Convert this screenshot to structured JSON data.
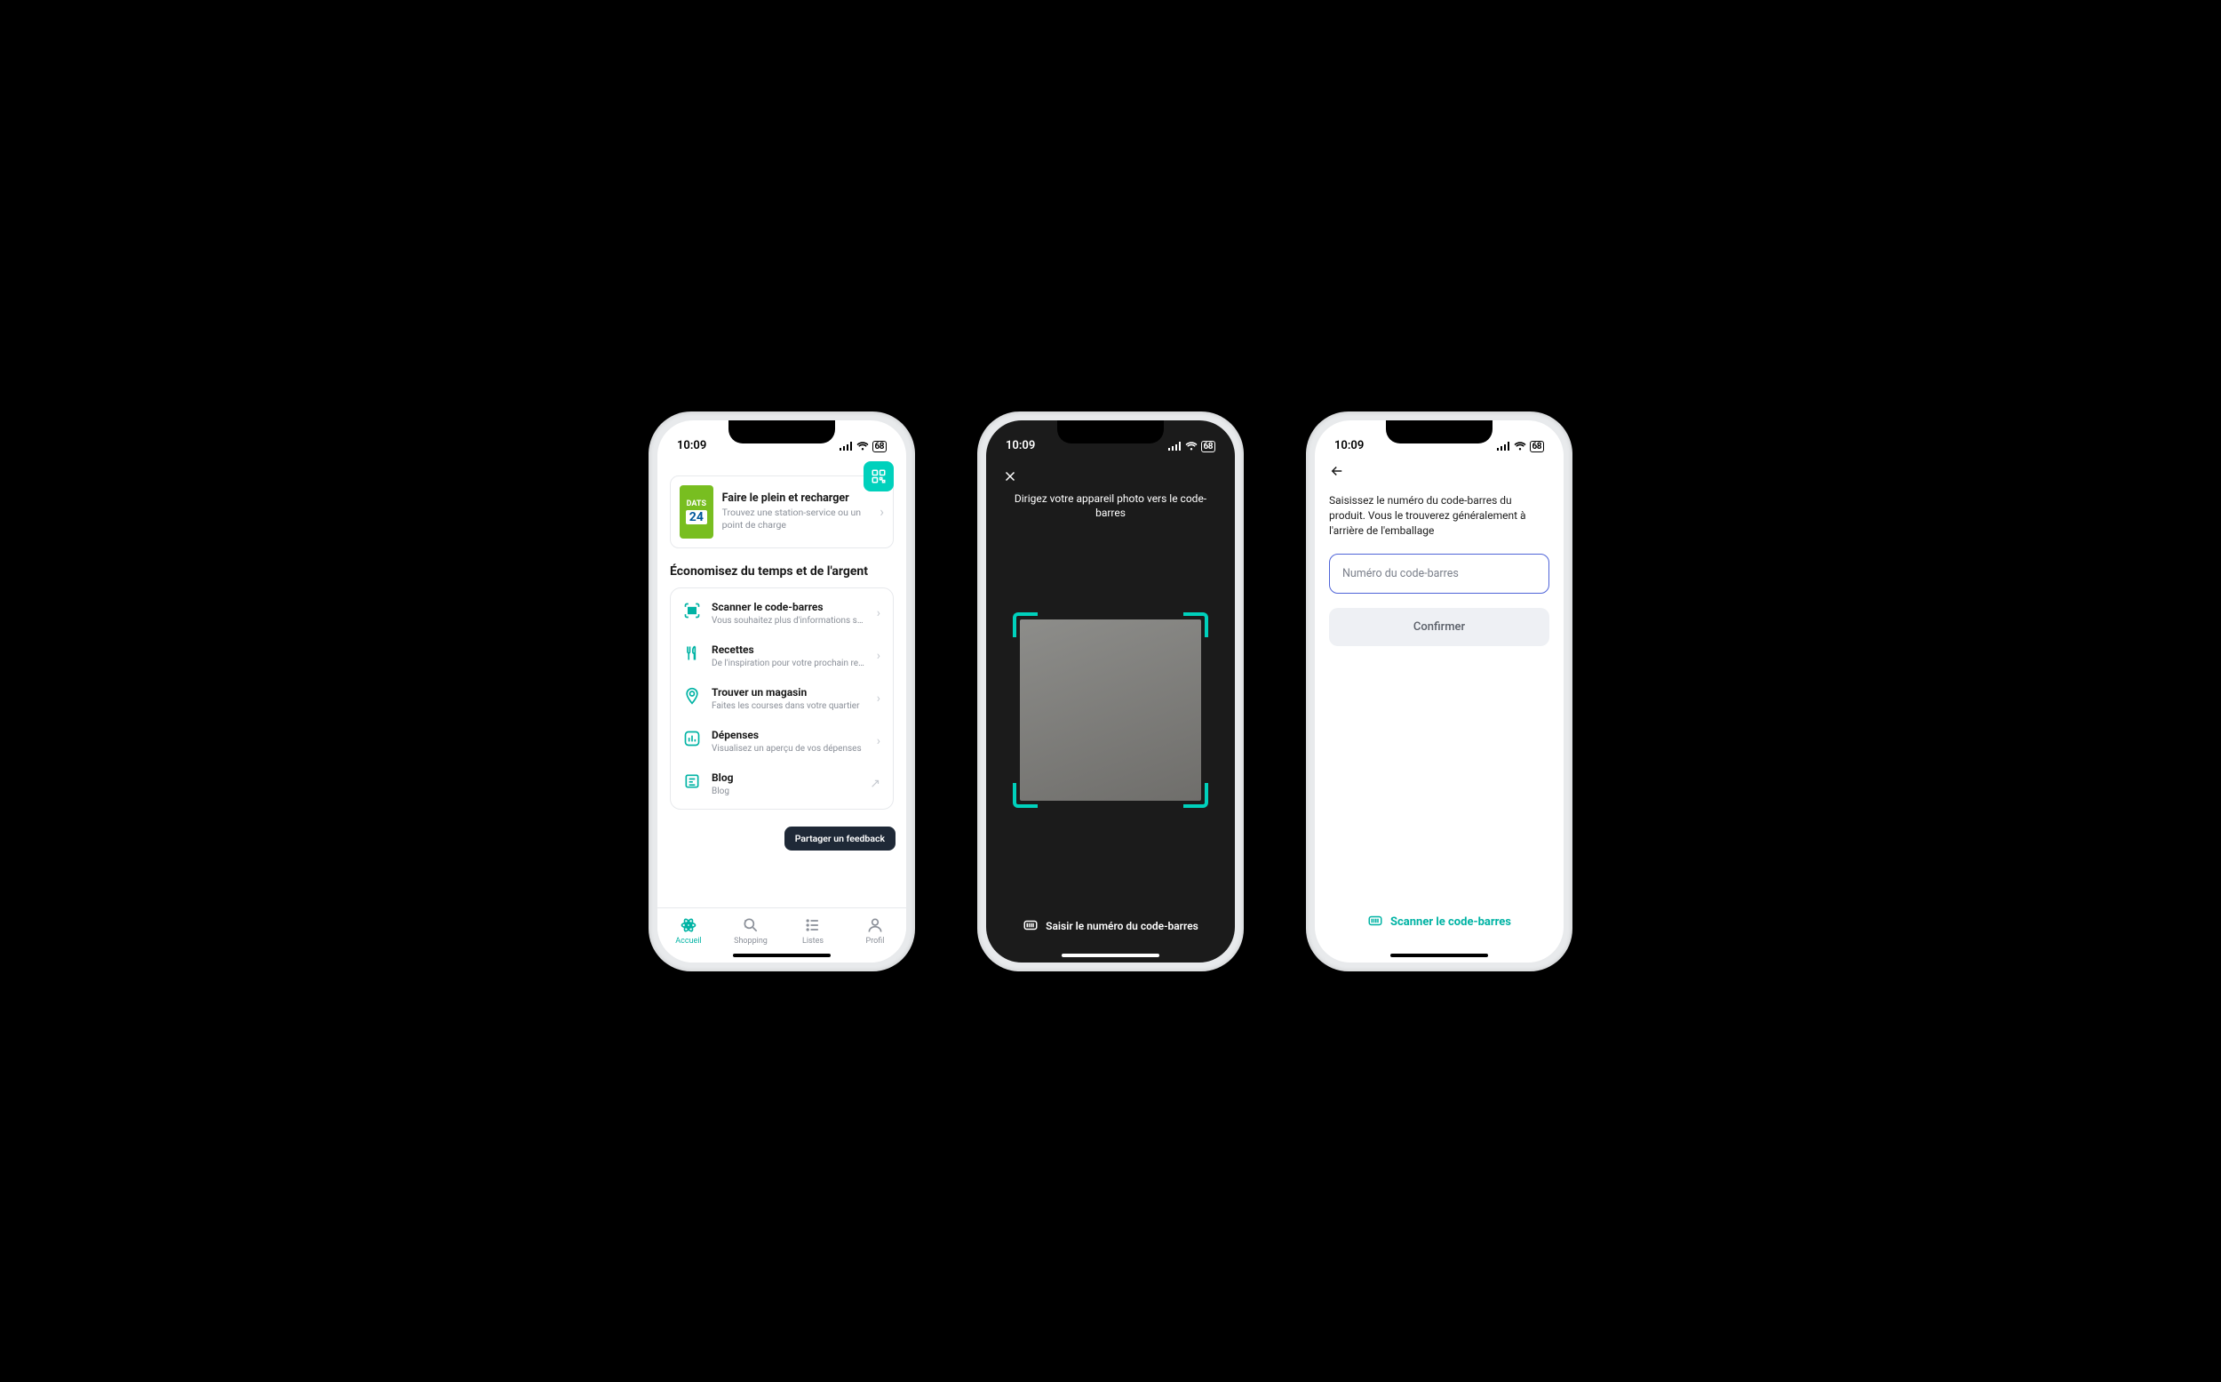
{
  "status": {
    "time": "10:09",
    "battery": "68"
  },
  "screen1": {
    "dats": {
      "brand_line1": "DATS",
      "brand_line2": "24",
      "title": "Faire le plein et recharger",
      "subtitle": "Trouvez une station-service ou un point de charge"
    },
    "section_title": "Économisez du temps et de l'argent",
    "items": [
      {
        "title": "Scanner le code-barres",
        "sub": "Vous souhaitez plus d'informations sur…"
      },
      {
        "title": "Recettes",
        "sub": "De l'inspiration pour votre prochain rep…"
      },
      {
        "title": "Trouver un magasin",
        "sub": "Faites les courses dans votre quartier"
      },
      {
        "title": "Dépenses",
        "sub": "Visualisez un aperçu de vos dépenses"
      },
      {
        "title": "Blog",
        "sub": "Blog"
      }
    ],
    "feedback": "Partager un feedback",
    "tabs": {
      "home": "Accueil",
      "shopping": "Shopping",
      "lists": "Listes",
      "profile": "Profil"
    }
  },
  "screen2": {
    "instruction": "Dirigez votre appareil photo vers le code-barres",
    "bottom_link": "Saisir le numéro du code-barres"
  },
  "screen3": {
    "instruction": "Saisissez le numéro du code-barres du produit. Vous le trouverez généralement à l'arrière de l'emballage",
    "placeholder": "Numéro du code-barres",
    "confirm": "Confirmer",
    "scan_link": "Scanner le code-barres"
  }
}
